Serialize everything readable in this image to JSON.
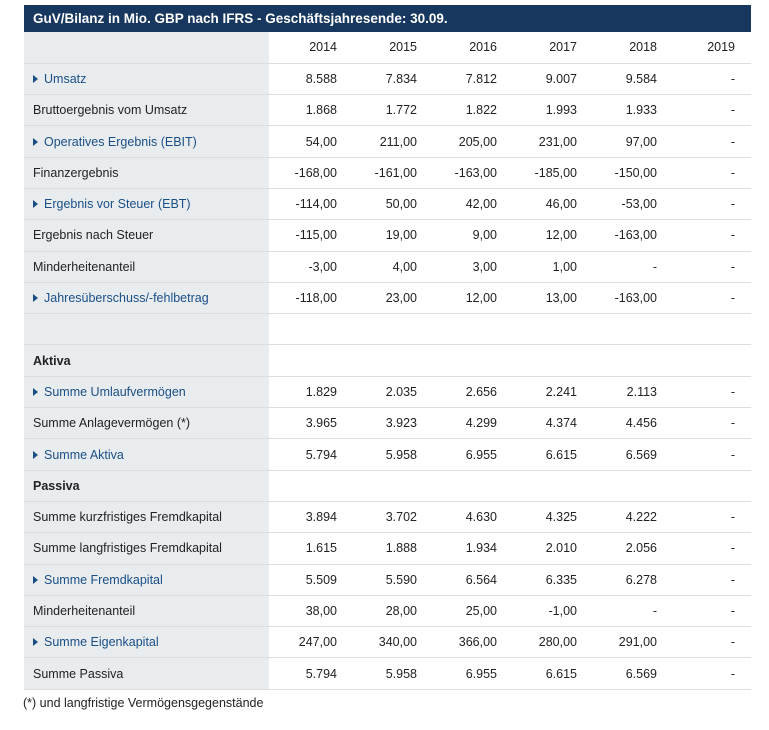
{
  "title": "GuV/Bilanz in Mio. GBP nach IFRS - Geschäftsjahresende: 30.09.",
  "years": [
    "2014",
    "2015",
    "2016",
    "2017",
    "2018",
    "2019"
  ],
  "rows": [
    {
      "label": "Umsatz",
      "link": true,
      "values": [
        "8.588",
        "7.834",
        "7.812",
        "9.007",
        "9.584",
        "-"
      ]
    },
    {
      "label": "Bruttoergebnis vom Umsatz",
      "link": false,
      "values": [
        "1.868",
        "1.772",
        "1.822",
        "1.993",
        "1.933",
        "-"
      ]
    },
    {
      "label": "Operatives Ergebnis (EBIT)",
      "link": true,
      "values": [
        "54,00",
        "211,00",
        "205,00",
        "231,00",
        "97,00",
        "-"
      ]
    },
    {
      "label": "Finanzergebnis",
      "link": false,
      "values": [
        "-168,00",
        "-161,00",
        "-163,00",
        "-185,00",
        "-150,00",
        "-"
      ]
    },
    {
      "label": "Ergebnis vor Steuer (EBT)",
      "link": true,
      "values": [
        "-114,00",
        "50,00",
        "42,00",
        "46,00",
        "-53,00",
        "-"
      ]
    },
    {
      "label": "Ergebnis nach Steuer",
      "link": false,
      "values": [
        "-115,00",
        "19,00",
        "9,00",
        "12,00",
        "-163,00",
        "-"
      ]
    },
    {
      "label": "Minderheitenanteil",
      "link": false,
      "values": [
        "-3,00",
        "4,00",
        "3,00",
        "1,00",
        "-",
        "-"
      ]
    },
    {
      "label": "Jahresüberschuss/-fehlbetrag",
      "link": true,
      "values": [
        "-118,00",
        "23,00",
        "12,00",
        "13,00",
        "-163,00",
        "-"
      ]
    },
    {
      "label": "",
      "link": false,
      "spacer": true,
      "values": [
        "",
        "",
        "",
        "",
        "",
        ""
      ]
    },
    {
      "label": "Aktiva",
      "link": false,
      "section": true,
      "values": [
        "",
        "",
        "",
        "",
        "",
        ""
      ]
    },
    {
      "label": "Summe Umlaufvermögen",
      "link": true,
      "values": [
        "1.829",
        "2.035",
        "2.656",
        "2.241",
        "2.113",
        "-"
      ]
    },
    {
      "label": "Summe Anlagevermögen (*)",
      "link": false,
      "values": [
        "3.965",
        "3.923",
        "4.299",
        "4.374",
        "4.456",
        "-"
      ]
    },
    {
      "label": "Summe Aktiva",
      "link": true,
      "values": [
        "5.794",
        "5.958",
        "6.955",
        "6.615",
        "6.569",
        "-"
      ]
    },
    {
      "label": "Passiva",
      "link": false,
      "section": true,
      "values": [
        "",
        "",
        "",
        "",
        "",
        ""
      ]
    },
    {
      "label": "Summe kurzfristiges Fremdkapital",
      "link": false,
      "values": [
        "3.894",
        "3.702",
        "4.630",
        "4.325",
        "4.222",
        "-"
      ]
    },
    {
      "label": "Summe langfristiges Fremdkapital",
      "link": false,
      "values": [
        "1.615",
        "1.888",
        "1.934",
        "2.010",
        "2.056",
        "-"
      ]
    },
    {
      "label": "Summe Fremdkapital",
      "link": true,
      "values": [
        "5.509",
        "5.590",
        "6.564",
        "6.335",
        "6.278",
        "-"
      ]
    },
    {
      "label": "Minderheitenanteil",
      "link": false,
      "values": [
        "38,00",
        "28,00",
        "25,00",
        "-1,00",
        "-",
        "-"
      ]
    },
    {
      "label": "Summe Eigenkapital",
      "link": true,
      "values": [
        "247,00",
        "340,00",
        "366,00",
        "280,00",
        "291,00",
        "-"
      ]
    },
    {
      "label": "Summe Passiva",
      "link": false,
      "values": [
        "5.794",
        "5.958",
        "6.955",
        "6.615",
        "6.569",
        "-"
      ]
    }
  ],
  "footnote": "(*) und langfristige Vermögensgegenstände",
  "colors": {
    "header_bg": "#17375e",
    "label_bg": "#e9ecef",
    "link": "#1a4f86"
  }
}
